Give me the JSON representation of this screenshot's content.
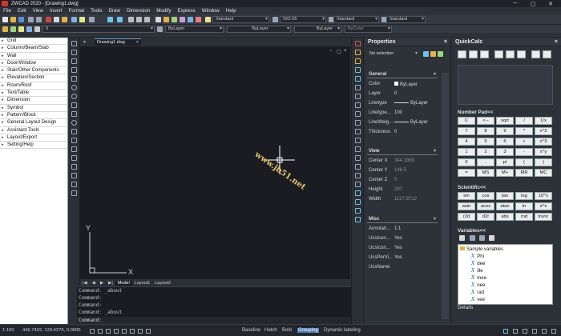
{
  "app": {
    "title": "ZWCAD 2020 - [Drawing1.dwg]",
    "window_controls": [
      "─",
      "▢",
      "✕"
    ]
  },
  "menu": [
    "File",
    "Edit",
    "View",
    "Insert",
    "Format",
    "Tools",
    "Draw",
    "Dimension",
    "Modify",
    "Express",
    "Window",
    "Help"
  ],
  "toolbar": {
    "text_style": "Standard",
    "dim_style": "ISO-25",
    "table_style": "Standard",
    "mleader_style": "Standard",
    "layer": "0",
    "color": "ByLayer",
    "linetype": "ByLayer",
    "lineweight": "ByLayer",
    "plot_style": "ByColor"
  },
  "left_panel": {
    "items": [
      "Grid",
      "Column/Beam/Slab",
      "Wall",
      "Door/Window",
      "Stair/Other Components",
      "Elevation/Section",
      "Room/Roof",
      "Text/Table",
      "Dimension",
      "Symbol",
      "Pattern/Block",
      "General Layout Design",
      "Assistant Tools",
      "Layout/Export",
      "Setting/Help"
    ]
  },
  "document": {
    "tab": "Drawing1.dwg",
    "tab_close": "×",
    "canvas_controls": [
      "▫",
      "▢",
      "×"
    ],
    "ucs_x": "X",
    "ucs_y": "Y",
    "watermark": "www.jb51.net",
    "layout_nav": [
      "|◀",
      "◀",
      "▶",
      "▶|"
    ],
    "layout_tabs": [
      "Model",
      "Layout1",
      "Layout2"
    ]
  },
  "command": {
    "history": [
      "Command: _about",
      "Command:",
      "Command:",
      "Command: _about"
    ],
    "prompt": "Command:"
  },
  "properties": {
    "title": "Properties",
    "close": "×",
    "selection": "No selection",
    "sections": {
      "general": "General",
      "view": "View",
      "misc": "Misc"
    },
    "general_rows": [
      {
        "label": "Color",
        "value": "ByLayer"
      },
      {
        "label": "Layer",
        "value": "0"
      },
      {
        "label": "Linetype",
        "value": "ByLayer"
      },
      {
        "label": "Linetype...",
        "value": "100"
      },
      {
        "label": "LineWeig...",
        "value": "ByLayer"
      },
      {
        "label": "Thickness",
        "value": "0"
      }
    ],
    "view_rows": [
      {
        "label": "Center X",
        "value": "344.1869"
      },
      {
        "label": "Center Y",
        "value": "148.5"
      },
      {
        "label": "Center Z",
        "value": "0"
      },
      {
        "label": "Height",
        "value": "297"
      },
      {
        "label": "Width",
        "value": "1127.8712"
      }
    ],
    "misc_rows": [
      {
        "label": "Annotati...",
        "value": "1:1"
      },
      {
        "label": "UcsIcon...",
        "value": "Yes"
      },
      {
        "label": "UcsIcon...",
        "value": "Yes"
      },
      {
        "label": "UcsPerVi...",
        "value": "Yes"
      },
      {
        "label": "UcsName",
        "value": ""
      }
    ]
  },
  "quickcalc": {
    "title": "QuickCalc",
    "close": "×",
    "number_pad_title": "Number Pad<<",
    "number_pad": [
      [
        "C",
        "<--",
        "sqrt",
        "/",
        "1/x"
      ],
      [
        "7",
        "8",
        "9",
        "*",
        "x^2"
      ],
      [
        "4",
        "5",
        "6",
        "+",
        "x^3"
      ],
      [
        "1",
        "2",
        "3",
        "-",
        "x^y"
      ],
      [
        "0",
        ".",
        "pi",
        "(",
        ")"
      ],
      [
        "=",
        "MS",
        "M+",
        "MR",
        "MC"
      ]
    ],
    "scientific_title": "Scientific<<",
    "scientific": [
      [
        "sin",
        "cos",
        "tan",
        "log",
        "10^x"
      ],
      [
        "asin",
        "acos",
        "atan",
        "ln",
        "e^x"
      ],
      [
        "r2d",
        "d2r",
        "abs",
        "rnd",
        "trunc"
      ]
    ],
    "variables_title": "Variables<<",
    "variables_root": "Sample variables",
    "variables": [
      "Phi",
      "dee",
      "ille",
      "mee",
      "nee",
      "rad",
      "vee"
    ],
    "details_label": "Details"
  },
  "status": {
    "coordinates": "445.7402, 133.4276, 0.0000",
    "scale": "1:100",
    "modes": [
      "Baseline",
      "Hatch",
      "Bold",
      "Grouping",
      "Dynamic labeling"
    ],
    "active_mode": "Grouping"
  },
  "colors": {
    "accent": "#4b7cb8",
    "canvas": "#1a1c22",
    "brand": "#d0342c"
  }
}
